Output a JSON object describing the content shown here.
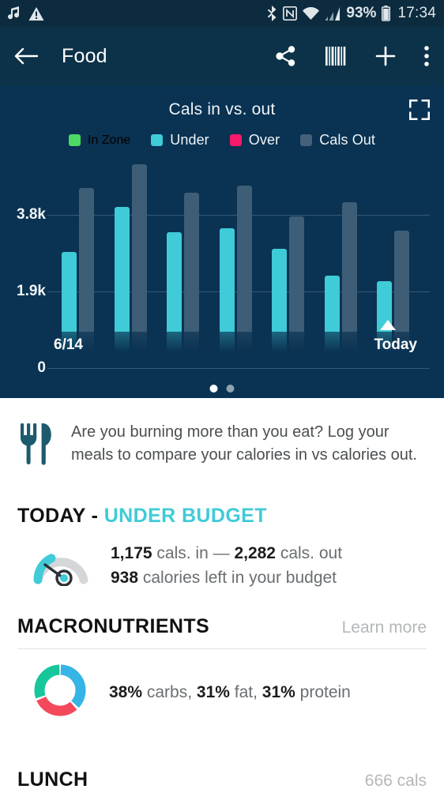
{
  "status_bar": {
    "icons_left": [
      "music-note-icon",
      "warning-triangle-icon"
    ],
    "icons_right": [
      "bluetooth-icon",
      "nfc-icon",
      "wifi-icon",
      "cellular-signal-icon"
    ],
    "battery_percent": "93%",
    "time": "17:34"
  },
  "app_bar": {
    "back_label": "←",
    "title": "Food",
    "actions": [
      {
        "name": "share-icon"
      },
      {
        "name": "barcode-scan-icon"
      },
      {
        "name": "add-icon"
      },
      {
        "name": "overflow-menu-icon"
      }
    ]
  },
  "chart_card": {
    "title": "Cals in vs. out",
    "expand_icon": "fullscreen-icon",
    "legend": [
      {
        "label": "In Zone",
        "color": "#4cd964"
      },
      {
        "label": "Under",
        "color": "#3fcbd7"
      },
      {
        "label": "Over",
        "color": "#f5196c"
      },
      {
        "label": "Cals Out",
        "color": "#44607a"
      }
    ],
    "pager": {
      "count": 2,
      "active_index": 0
    }
  },
  "chart_data": {
    "type": "bar",
    "title": "Cals in vs. out",
    "xlabel": "",
    "ylabel": "",
    "categories": [
      "6/14",
      "",
      "",
      "",
      "",
      "",
      "Today"
    ],
    "x_tick_labels": {
      "first": "6/14",
      "last": "Today"
    },
    "y_tick_labels": [
      "0",
      "1.9k",
      "3.8k"
    ],
    "y_tick_values": [
      0,
      1900,
      3800
    ],
    "ylim": [
      0,
      4200
    ],
    "grid": true,
    "legend_position": "top",
    "today_marker_index": 6,
    "series": [
      {
        "name": "Under",
        "color": "#3fcbd7",
        "values": [
          1990,
          3110,
          2480,
          2580,
          2060,
          1390,
          1250
        ]
      },
      {
        "name": "Cals Out",
        "color": "#3e5e77",
        "values": [
          3580,
          4160,
          3450,
          3640,
          2870,
          3220,
          2510
        ]
      }
    ]
  },
  "tip": {
    "icon": "fork-knife-icon",
    "text": "Are you burning more than you eat? Log your meals to compare your calories in vs calories out."
  },
  "today_section": {
    "title": "TODAY - ",
    "status": "UNDER BUDGET",
    "gauge_icon": "gauge-icon",
    "line1_value_in": "1,175",
    "line1_mid": " cals. in — ",
    "line1_value_out": "2,282",
    "line1_tail": " cals. out",
    "line2_value": "938",
    "line2_tail": " calories left in your budget"
  },
  "macronutrients": {
    "title": "MACRONUTRIENTS",
    "link": "Learn more",
    "donut_icon": "macros-donut-chart",
    "carbs_pct": "38%",
    "carbs_label": " carbs, ",
    "fat_pct": "31%",
    "fat_label": " fat, ",
    "protein_pct": "31%",
    "protein_label": " protein",
    "colors": {
      "carbs": "#36b4e5",
      "fat": "#f4485b",
      "protein": "#17c69b"
    }
  },
  "lunch": {
    "title": "LUNCH",
    "calories": "666 cals"
  }
}
